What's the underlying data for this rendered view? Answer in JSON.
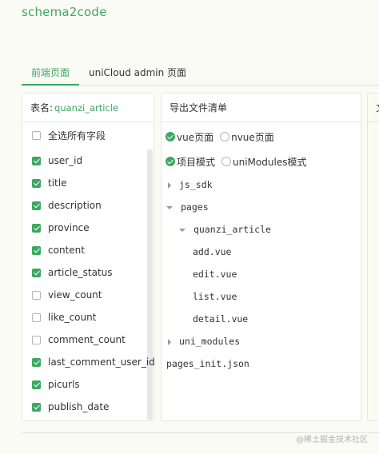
{
  "app_title": "schema2code",
  "tabs": [
    {
      "label": "前端页面",
      "active": true
    },
    {
      "label": "uniCloud admin 页面",
      "active": false
    }
  ],
  "field_panel": {
    "table_label": "表名:",
    "table_name": "quanzi_article",
    "select_all_label": "全选所有字段",
    "select_all_checked": false,
    "fields": [
      {
        "label": "user_id",
        "checked": true
      },
      {
        "label": "title",
        "checked": true
      },
      {
        "label": "description",
        "checked": true
      },
      {
        "label": "province",
        "checked": true
      },
      {
        "label": "content",
        "checked": true
      },
      {
        "label": "article_status",
        "checked": true
      },
      {
        "label": "view_count",
        "checked": false
      },
      {
        "label": "like_count",
        "checked": false
      },
      {
        "label": "comment_count",
        "checked": false
      },
      {
        "label": "last_comment_user_id",
        "checked": true
      },
      {
        "label": "picurls",
        "checked": true
      },
      {
        "label": "publish_date",
        "checked": true
      }
    ]
  },
  "export_panel": {
    "title": "导出文件清单",
    "page_type": [
      {
        "label": "vue页面",
        "checked": true
      },
      {
        "label": "nvue页面",
        "checked": false
      }
    ],
    "mode": [
      {
        "label": "项目模式",
        "checked": true
      },
      {
        "label": "uniModules模式",
        "checked": false
      }
    ],
    "tree": [
      {
        "label": "js_sdk",
        "arrow": "right"
      },
      {
        "label": "pages",
        "arrow": "down"
      },
      {
        "label": "quanzi_article",
        "arrow": "down"
      },
      {
        "label": "add.vue",
        "arrow": ""
      },
      {
        "label": "edit.vue",
        "arrow": ""
      },
      {
        "label": "list.vue",
        "arrow": ""
      },
      {
        "label": "detail.vue",
        "arrow": ""
      },
      {
        "label": "uni_modules",
        "arrow": "right"
      },
      {
        "label": "pages_init.json",
        "arrow": ""
      }
    ]
  },
  "third_panel": {
    "header_char": "文"
  },
  "watermark": "@稀土掘金技术社区",
  "colors": {
    "accent": "#3ca863"
  }
}
